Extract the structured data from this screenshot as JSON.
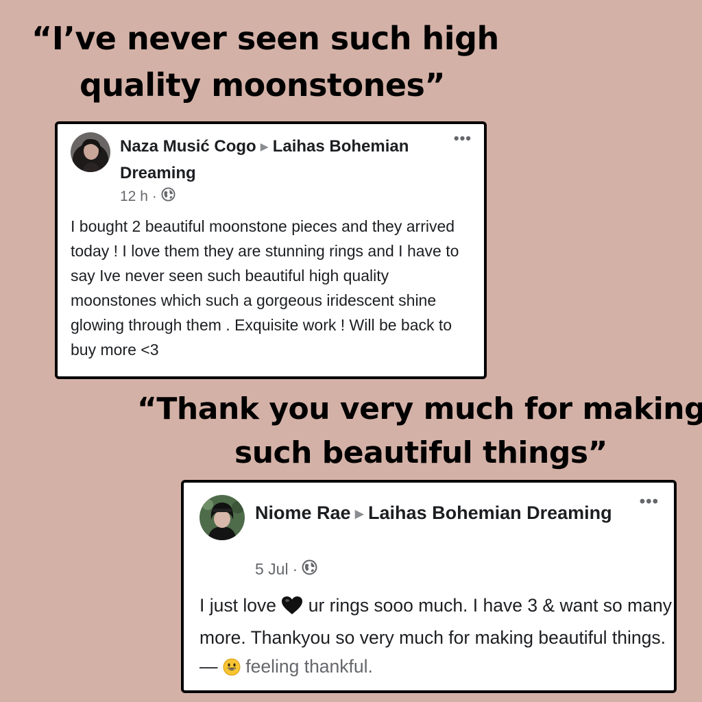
{
  "headline_1": {
    "line1": "“I’ve never seen such high",
    "line2": "quality moonstones”"
  },
  "post_1": {
    "author": "Naza Musić Cogo",
    "arrow": "▶",
    "page_name": "Laihas Bohemian Dreaming",
    "time": "12 h",
    "separator": "·",
    "privacy_icon": "globe-icon",
    "more": "•••",
    "text": "I bought 2 beautiful moonstone pieces and they arrived today ! I love them they are stunning rings and I have to say Ive never seen such beautiful high quality moonstones which such a gorgeous iridescent shine glowing through them . Exquisite work ! Will be back to buy more <3"
  },
  "headline_2": {
    "line1": "“Thank you very much for making",
    "line2": "such beautiful things”"
  },
  "post_2": {
    "author": "Niome Rae",
    "arrow": "▶",
    "page_name": "Laihas Bohemian Dreaming",
    "time": "5 Jul",
    "separator": "·",
    "privacy_icon": "globe-icon",
    "more": "•••",
    "text_part1": "I just love",
    "heart_icon": "black-heart-icon",
    "text_part2": "ur rings sooo much. I have 3 & want so many more. Thankyou so very much for making beautiful things. —",
    "feeling_icon": "grinning-face-icon",
    "feeling": "feeling thankful."
  },
  "colors": {
    "background": "#d4b1a7",
    "card": "#ffffff",
    "border": "#000000",
    "secondary_text": "#65676b"
  }
}
